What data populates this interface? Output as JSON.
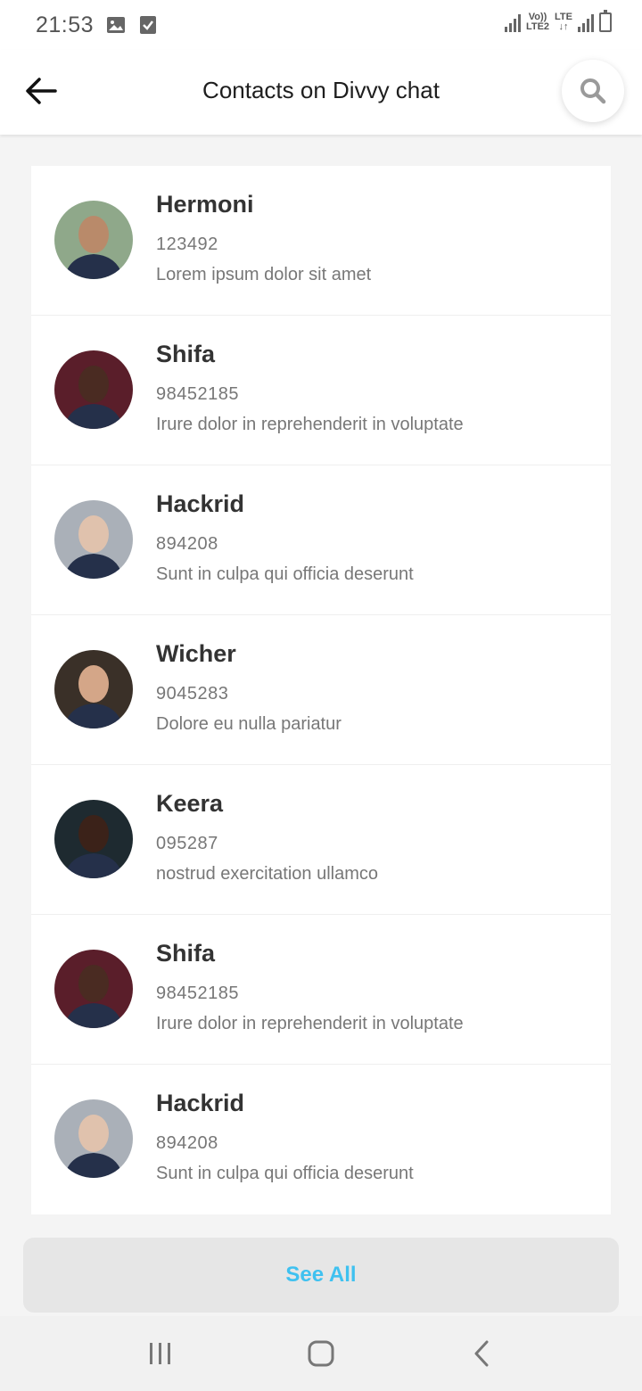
{
  "status_bar": {
    "time": "21:53",
    "network_label_top": "Vo))",
    "network_label_bottom": "LTE2",
    "lte_label": "LTE"
  },
  "header": {
    "title": "Contacts on Divvy chat",
    "back_icon": "arrow-left-icon",
    "search_icon": "search-icon"
  },
  "contacts": [
    {
      "name": "Hermoni",
      "number": "123492",
      "status": "Lorem ipsum dolor sit amet",
      "avatar_color": "#b98a6a",
      "avatar_bg": "#8fa88a"
    },
    {
      "name": "Shifa",
      "number": "98452185",
      "status": "Irure dolor in reprehenderit in voluptate",
      "avatar_color": "#4a2b22",
      "avatar_bg": "#5a1e2a"
    },
    {
      "name": "Hackrid",
      "number": "894208",
      "status": "Sunt in culpa qui officia deserunt",
      "avatar_color": "#e0c2ad",
      "avatar_bg": "#aab0b8"
    },
    {
      "name": "Wicher",
      "number": "9045283",
      "status": "Dolore eu nulla pariatur",
      "avatar_color": "#d4a688",
      "avatar_bg": "#3a3028"
    },
    {
      "name": "Keera",
      "number": "095287",
      "status": "nostrud exercitation ullamco",
      "avatar_color": "#3b2219",
      "avatar_bg": "#1e2a30"
    },
    {
      "name": "Shifa",
      "number": "98452185",
      "status": "Irure dolor in reprehenderit in voluptate",
      "avatar_color": "#4a2b22",
      "avatar_bg": "#5a1e2a"
    },
    {
      "name": "Hackrid",
      "number": "894208",
      "status": "Sunt in culpa qui officia deserunt",
      "avatar_color": "#e0c2ad",
      "avatar_bg": "#aab0b8"
    }
  ],
  "see_all_label": "See All",
  "colors": {
    "accent": "#3fc1f0",
    "background": "#f4f4f4"
  },
  "nav": {
    "recents_icon": "recents-icon",
    "home_icon": "home-icon",
    "back_icon": "nav-back-icon"
  }
}
